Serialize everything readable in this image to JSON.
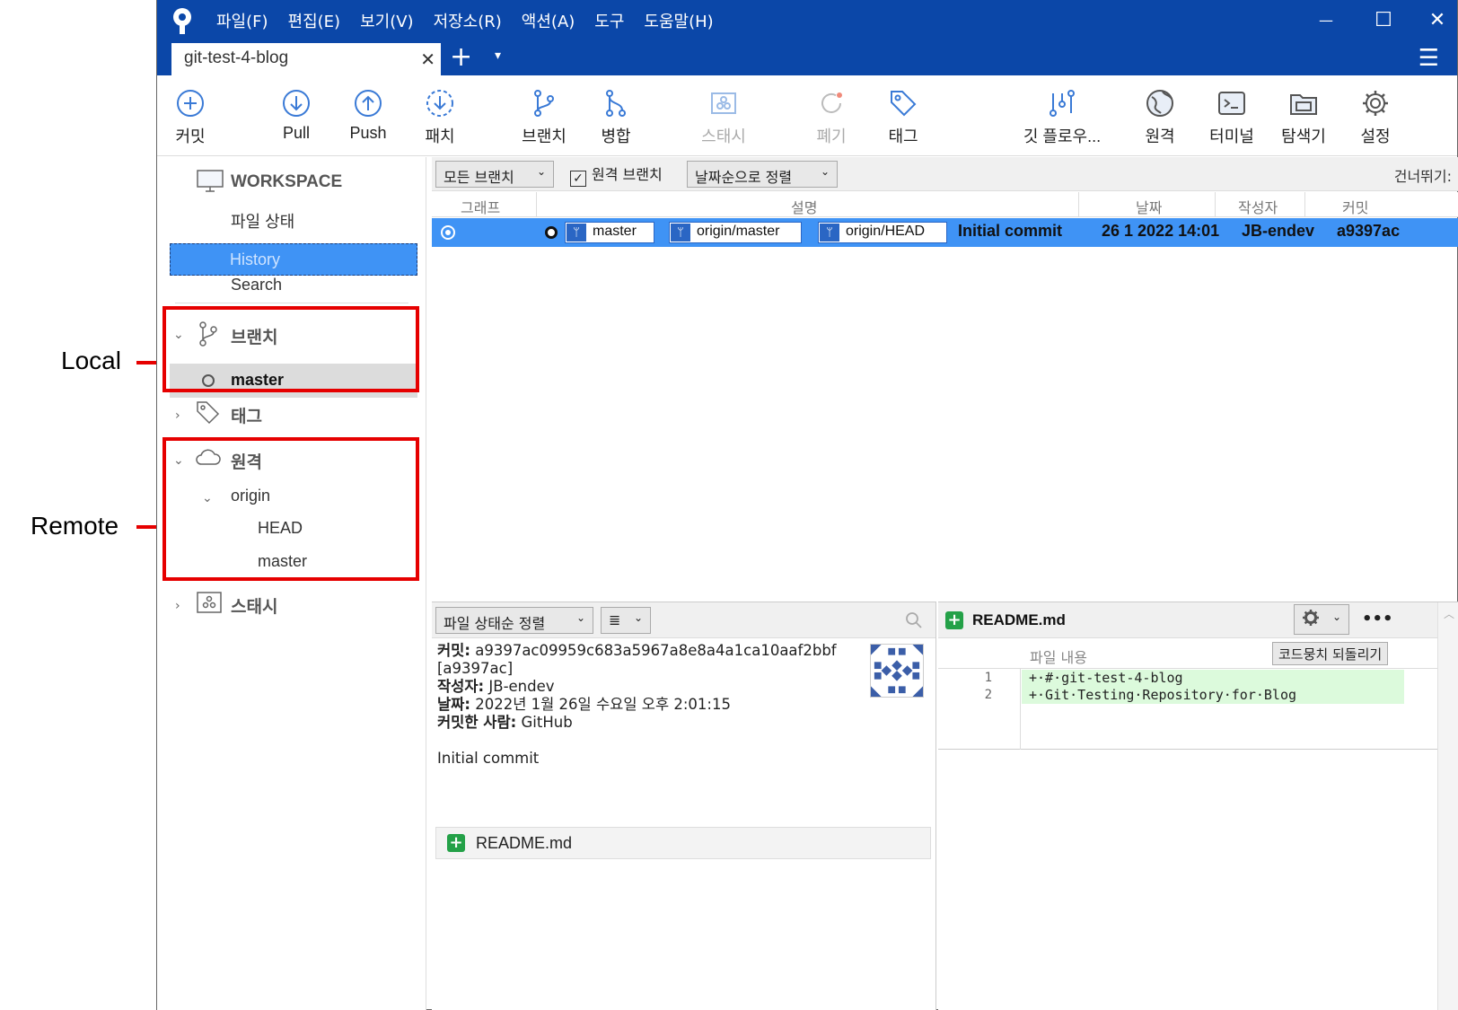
{
  "annotations": {
    "local": "Local",
    "remote": "Remote"
  },
  "titlebar": {
    "menu": [
      "파일(F)",
      "편집(E)",
      "보기(V)",
      "저장소(R)",
      "액션(A)",
      "도구",
      "도움말(H)"
    ],
    "tab_name": "git-test-4-blog",
    "tab_close": "✕",
    "tab_add": "+",
    "tab_dropdown": "▾",
    "minimize": "—",
    "maximize": "☐",
    "close": "✕",
    "hamburger": "☰"
  },
  "toolbar": {
    "commit": "커밋",
    "pull": "Pull",
    "push": "Push",
    "patch": "패치",
    "branch": "브랜치",
    "merge": "병합",
    "stash": "스태시",
    "discard": "폐기",
    "tag": "태그",
    "gitflow": "깃 플로우...",
    "remote": "원격",
    "terminal": "터미널",
    "explorer": "탐색기",
    "settings": "설정"
  },
  "sidebar": {
    "workspace": "WORKSPACE",
    "file_status": "파일 상태",
    "history": "History",
    "search": "Search",
    "branches": "브랜치",
    "branch_master": "master",
    "tags": "태그",
    "remotes": "원격",
    "origin": "origin",
    "origin_head": "HEAD",
    "origin_master": "master",
    "stashes": "스태시"
  },
  "filters": {
    "branches": "모든 브랜치",
    "remote_branches": "원격 브랜치",
    "sort": "날짜순으로 정렬",
    "skip": "건너뛰기:"
  },
  "columns": {
    "graph": "그래프",
    "description": "설명",
    "date": "날짜",
    "author": "작성자",
    "commit": "커밋"
  },
  "commit_row": {
    "refs": [
      "master",
      "origin/master",
      "origin/HEAD"
    ],
    "message": "Initial commit",
    "date": "26 1 2022 14:01",
    "author": "JB-endev",
    "hash": "a9397ac"
  },
  "details": {
    "sort": "파일 상태순 정렬",
    "view_icon": "≣",
    "commit_label": "커밋:",
    "commit_full": "a9397ac09959c683a5967a8e8a4a1ca10aaf2bbf",
    "commit_short": "[a9397ac]",
    "author_label": "작성자:",
    "author": "JB-endev",
    "date_label": "날짜:",
    "date": "2022년 1월 26일 수요일 오후 2:01:15",
    "committer_label": "커밋한 사람:",
    "committer": "GitHub",
    "message": "Initial commit",
    "file": "README.md"
  },
  "diff": {
    "file": "README.md",
    "header": "파일 내용",
    "revert_button": "코드뭉치 되돌리기",
    "more": "•••",
    "lines": [
      {
        "num": "1",
        "text": "+·#·git-test-4-blog"
      },
      {
        "num": "2",
        "text": "+·Git·Testing·Repository·for·Blog"
      }
    ]
  },
  "colors": {
    "title_bar": "#0b47a8",
    "selection": "#3f93f5",
    "annotation": "#e60000",
    "added": "#24a148"
  }
}
